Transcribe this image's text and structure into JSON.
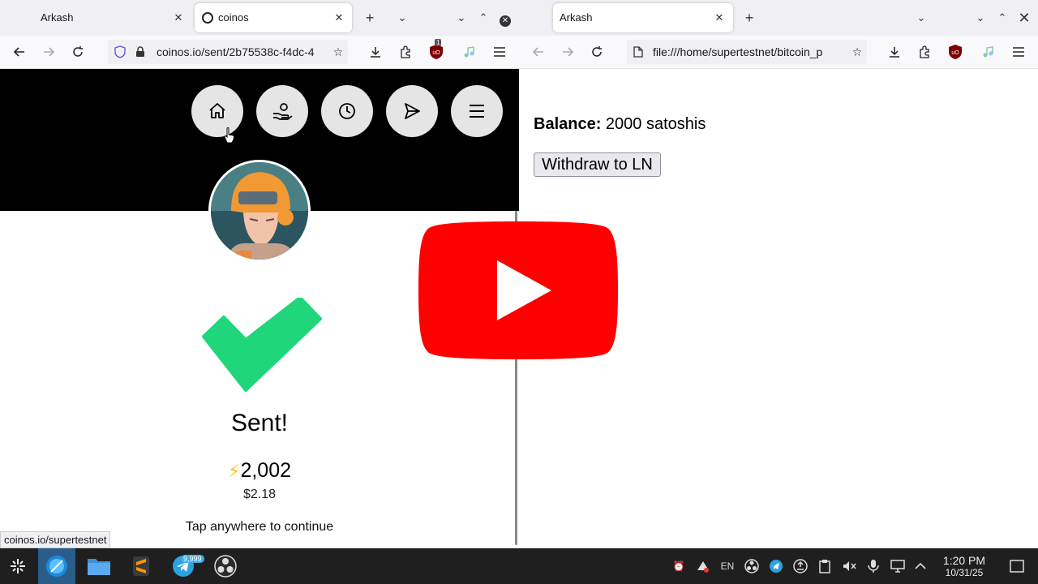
{
  "left_browser": {
    "tabs": [
      {
        "label": "Arkash",
        "active": false
      },
      {
        "label": "coinos",
        "active": true
      }
    ],
    "url": "coinos.io/sent/2b75538c-f4dc-4",
    "status_url": "coinos.io/supertestnet",
    "ublock_badge": "1"
  },
  "coinos": {
    "nav_icons": [
      "home-icon",
      "receive-icon",
      "history-icon",
      "send-icon",
      "menu-icon"
    ],
    "sent_title": "Sent!",
    "amount": "2,002",
    "fiat": "$2.18",
    "tap_hint": "Tap anywhere to continue",
    "accent_color": "#1fd67a"
  },
  "right_browser": {
    "tabs": [
      {
        "label": "Arkash",
        "active": true
      }
    ],
    "url": "file:///home/supertestnet/bitcoin_p",
    "balance_label": "Balance:",
    "balance_value": " 2000 satoshis",
    "withdraw_label": "Withdraw to LN"
  },
  "overlay": {
    "icon": "youtube-play-icon",
    "color": "#ff0000"
  },
  "taskbar": {
    "apps": [
      "app-launcher-icon",
      "browser-icon",
      "file-manager-icon",
      "sublime-text-icon",
      "telegram-icon",
      "obs-icon"
    ],
    "telegram_badge": "9,999",
    "keyboard_layout": "EN",
    "time": "1:20 PM",
    "date": "10/31/25"
  }
}
